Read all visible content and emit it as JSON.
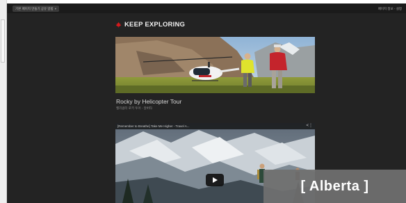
{
  "topbar": {
    "tab_label": "기본 페이지 만들기 공유 방법",
    "right_text": "페이지 정보 - 설정"
  },
  "brand": {
    "title": "KEEP EXPLORING",
    "logo_icon": "maple-leaf-icon",
    "accent": "#d7191c"
  },
  "card": {
    "title": "Rocky by Helicopter Tour",
    "subtitle": "헬리콥터 로키 투어 - 알버타"
  },
  "video": {
    "title": "[Remember to Breathe] Take Me Higher - Travel A...",
    "share_icon": "share-icon",
    "more_icon": "more-icon",
    "play_icon": "play-icon"
  },
  "badge": {
    "label": "[ Alberta ]"
  }
}
